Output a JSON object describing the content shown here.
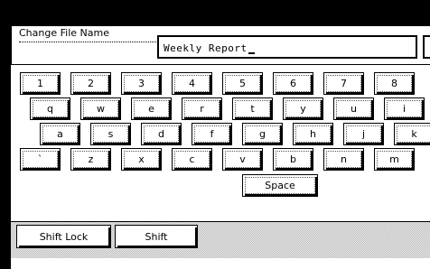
{
  "dialog": {
    "title": "Change File Name",
    "file_name_value": "Weekly Report"
  },
  "keyboard": {
    "row1": [
      "1",
      "2",
      "3",
      "4",
      "5",
      "6",
      "7",
      "8"
    ],
    "row2": [
      "q",
      "w",
      "e",
      "r",
      "t",
      "y",
      "u",
      "i"
    ],
    "row3": [
      "a",
      "s",
      "d",
      "f",
      "g",
      "h",
      "j",
      "k"
    ],
    "row4": [
      "`",
      "z",
      "x",
      "c",
      "v",
      "b",
      "n",
      "m"
    ],
    "space_label": "Space"
  },
  "bottom_bar": {
    "shift_lock_label": "Shift Lock",
    "shift_label": "Shift"
  }
}
